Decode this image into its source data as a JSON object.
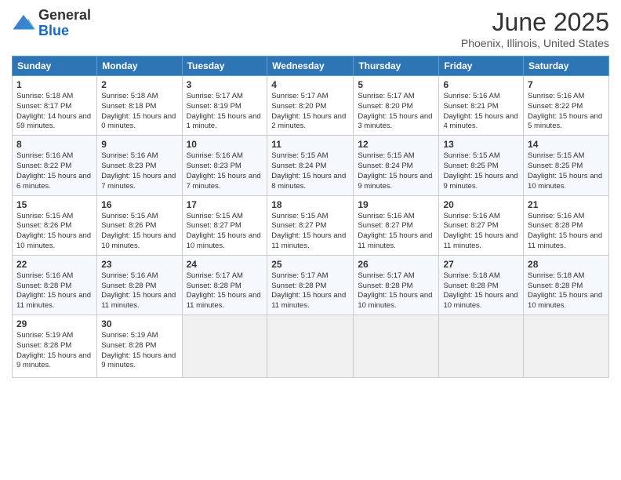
{
  "logo": {
    "general": "General",
    "blue": "Blue"
  },
  "title": "June 2025",
  "subtitle": "Phoenix, Illinois, United States",
  "headers": [
    "Sunday",
    "Monday",
    "Tuesday",
    "Wednesday",
    "Thursday",
    "Friday",
    "Saturday"
  ],
  "weeks": [
    [
      {
        "day": "1",
        "sunrise": "5:18 AM",
        "sunset": "8:17 PM",
        "daylight": "14 hours and 59 minutes."
      },
      {
        "day": "2",
        "sunrise": "5:18 AM",
        "sunset": "8:18 PM",
        "daylight": "15 hours and 0 minutes."
      },
      {
        "day": "3",
        "sunrise": "5:17 AM",
        "sunset": "8:19 PM",
        "daylight": "15 hours and 1 minute."
      },
      {
        "day": "4",
        "sunrise": "5:17 AM",
        "sunset": "8:20 PM",
        "daylight": "15 hours and 2 minutes."
      },
      {
        "day": "5",
        "sunrise": "5:17 AM",
        "sunset": "8:20 PM",
        "daylight": "15 hours and 3 minutes."
      },
      {
        "day": "6",
        "sunrise": "5:16 AM",
        "sunset": "8:21 PM",
        "daylight": "15 hours and 4 minutes."
      },
      {
        "day": "7",
        "sunrise": "5:16 AM",
        "sunset": "8:22 PM",
        "daylight": "15 hours and 5 minutes."
      }
    ],
    [
      {
        "day": "8",
        "sunrise": "5:16 AM",
        "sunset": "8:22 PM",
        "daylight": "15 hours and 6 minutes."
      },
      {
        "day": "9",
        "sunrise": "5:16 AM",
        "sunset": "8:23 PM",
        "daylight": "15 hours and 7 minutes."
      },
      {
        "day": "10",
        "sunrise": "5:16 AM",
        "sunset": "8:23 PM",
        "daylight": "15 hours and 7 minutes."
      },
      {
        "day": "11",
        "sunrise": "5:15 AM",
        "sunset": "8:24 PM",
        "daylight": "15 hours and 8 minutes."
      },
      {
        "day": "12",
        "sunrise": "5:15 AM",
        "sunset": "8:24 PM",
        "daylight": "15 hours and 9 minutes."
      },
      {
        "day": "13",
        "sunrise": "5:15 AM",
        "sunset": "8:25 PM",
        "daylight": "15 hours and 9 minutes."
      },
      {
        "day": "14",
        "sunrise": "5:15 AM",
        "sunset": "8:25 PM",
        "daylight": "15 hours and 10 minutes."
      }
    ],
    [
      {
        "day": "15",
        "sunrise": "5:15 AM",
        "sunset": "8:26 PM",
        "daylight": "15 hours and 10 minutes."
      },
      {
        "day": "16",
        "sunrise": "5:15 AM",
        "sunset": "8:26 PM",
        "daylight": "15 hours and 10 minutes."
      },
      {
        "day": "17",
        "sunrise": "5:15 AM",
        "sunset": "8:27 PM",
        "daylight": "15 hours and 10 minutes."
      },
      {
        "day": "18",
        "sunrise": "5:15 AM",
        "sunset": "8:27 PM",
        "daylight": "15 hours and 11 minutes."
      },
      {
        "day": "19",
        "sunrise": "5:16 AM",
        "sunset": "8:27 PM",
        "daylight": "15 hours and 11 minutes."
      },
      {
        "day": "20",
        "sunrise": "5:16 AM",
        "sunset": "8:27 PM",
        "daylight": "15 hours and 11 minutes."
      },
      {
        "day": "21",
        "sunrise": "5:16 AM",
        "sunset": "8:28 PM",
        "daylight": "15 hours and 11 minutes."
      }
    ],
    [
      {
        "day": "22",
        "sunrise": "5:16 AM",
        "sunset": "8:28 PM",
        "daylight": "15 hours and 11 minutes."
      },
      {
        "day": "23",
        "sunrise": "5:16 AM",
        "sunset": "8:28 PM",
        "daylight": "15 hours and 11 minutes."
      },
      {
        "day": "24",
        "sunrise": "5:17 AM",
        "sunset": "8:28 PM",
        "daylight": "15 hours and 11 minutes."
      },
      {
        "day": "25",
        "sunrise": "5:17 AM",
        "sunset": "8:28 PM",
        "daylight": "15 hours and 11 minutes."
      },
      {
        "day": "26",
        "sunrise": "5:17 AM",
        "sunset": "8:28 PM",
        "daylight": "15 hours and 10 minutes."
      },
      {
        "day": "27",
        "sunrise": "5:18 AM",
        "sunset": "8:28 PM",
        "daylight": "15 hours and 10 minutes."
      },
      {
        "day": "28",
        "sunrise": "5:18 AM",
        "sunset": "8:28 PM",
        "daylight": "15 hours and 10 minutes."
      }
    ],
    [
      {
        "day": "29",
        "sunrise": "5:19 AM",
        "sunset": "8:28 PM",
        "daylight": "15 hours and 9 minutes."
      },
      {
        "day": "30",
        "sunrise": "5:19 AM",
        "sunset": "8:28 PM",
        "daylight": "15 hours and 9 minutes."
      },
      null,
      null,
      null,
      null,
      null
    ]
  ],
  "labels": {
    "sunrise": "Sunrise:",
    "sunset": "Sunset:",
    "daylight": "Daylight:"
  }
}
